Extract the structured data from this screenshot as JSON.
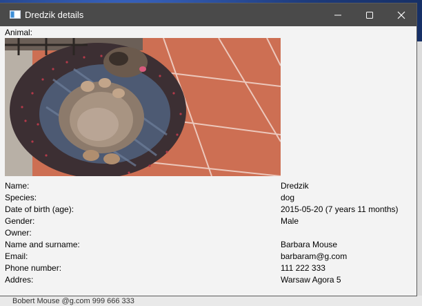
{
  "window": {
    "title": "Dredzik details",
    "icon": "app-window-icon"
  },
  "labels": {
    "animal": "Animal:",
    "name": "Name:",
    "species": "Species:",
    "dob": "Date of birth (age):",
    "gender": "Gender:",
    "owner": "Owner:",
    "name_surname": "Name and surname:",
    "email": "Email:",
    "phone": "Phone number:",
    "address": "Addres:"
  },
  "values": {
    "name": "Dredzik",
    "species": "dog",
    "dob": "2015-05-20 (7 years 11 months)",
    "gender": "Male",
    "owner": "",
    "name_surname": "Barbara Mouse",
    "email": "barbaram@g.com",
    "phone": "111 222 333",
    "address": "Warsaw Agora 5"
  },
  "background_partial_text": "Bobert           Mouse                  @g.com    999 666 333"
}
